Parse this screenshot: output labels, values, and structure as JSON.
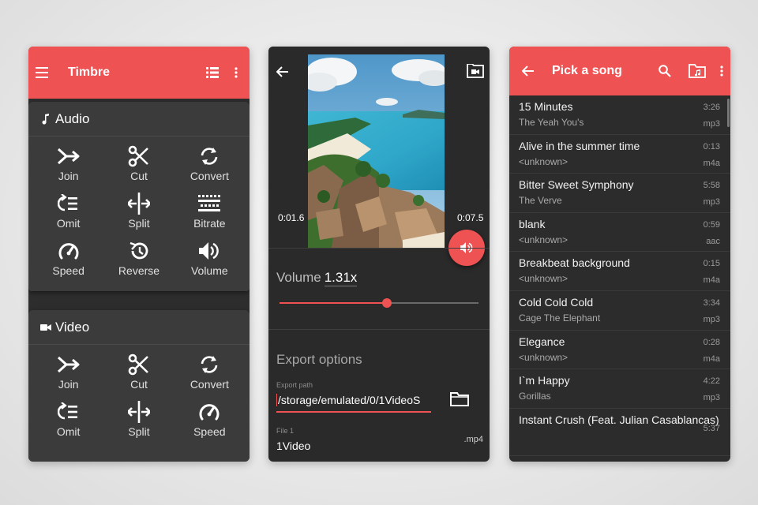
{
  "panel1": {
    "title": "Timbre",
    "audio": {
      "heading": "Audio",
      "tools": [
        {
          "label": "Join",
          "icon": "join-icon"
        },
        {
          "label": "Cut",
          "icon": "scissors-icon"
        },
        {
          "label": "Convert",
          "icon": "convert-icon"
        },
        {
          "label": "Omit",
          "icon": "omit-icon"
        },
        {
          "label": "Split",
          "icon": "split-icon"
        },
        {
          "label": "Bitrate",
          "icon": "bitrate-icon"
        },
        {
          "label": "Speed",
          "icon": "speed-icon"
        },
        {
          "label": "Reverse",
          "icon": "reverse-icon"
        },
        {
          "label": "Volume",
          "icon": "volume-icon"
        }
      ]
    },
    "video": {
      "heading": "Video",
      "tools": [
        {
          "label": "Join",
          "icon": "join-icon"
        },
        {
          "label": "Cut",
          "icon": "scissors-icon"
        },
        {
          "label": "Convert",
          "icon": "convert-icon"
        },
        {
          "label": "Omit",
          "icon": "omit-icon"
        },
        {
          "label": "Split",
          "icon": "split-icon"
        },
        {
          "label": "Speed",
          "icon": "speed-icon"
        }
      ]
    }
  },
  "panel2": {
    "time_start": "0:01.6",
    "time_end": "0:07.5",
    "volume_label": "Volume",
    "volume_value": "1.31x",
    "volume_fraction": 0.54,
    "export_title": "Export options",
    "export_path_label": "Export path",
    "export_path": "/storage/emulated/0/1VideoS",
    "file_label": "File 1",
    "file_name": "1Video",
    "file_ext": ".mp4"
  },
  "panel3": {
    "title": "Pick a song",
    "songs": [
      {
        "name": "15 Minutes",
        "artist": "The Yeah You's",
        "duration": "3:26",
        "format": "mp3"
      },
      {
        "name": "Alive in the summer time",
        "artist": "<unknown>",
        "duration": "0:13",
        "format": "m4a"
      },
      {
        "name": "Bitter Sweet Symphony",
        "artist": "The Verve",
        "duration": "5:58",
        "format": "mp3"
      },
      {
        "name": "blank",
        "artist": "<unknown>",
        "duration": "0:59",
        "format": "aac"
      },
      {
        "name": "Breakbeat background",
        "artist": "<unknown>",
        "duration": "0:15",
        "format": "m4a"
      },
      {
        "name": "Cold Cold Cold",
        "artist": "Cage The Elephant",
        "duration": "3:34",
        "format": "mp3"
      },
      {
        "name": "Elegance",
        "artist": "<unknown>",
        "duration": "0:28",
        "format": "m4a"
      },
      {
        "name": "I`m Happy",
        "artist": "Gorillas",
        "duration": "4:22",
        "format": "mp3"
      },
      {
        "name": "Instant Crush (Feat. Julian Casablancas)",
        "artist": "",
        "duration": "5:37",
        "format": ""
      }
    ]
  },
  "colors": {
    "accent": "#ee5253",
    "surface": "#2d2d2d",
    "card": "#3b3b3b"
  }
}
